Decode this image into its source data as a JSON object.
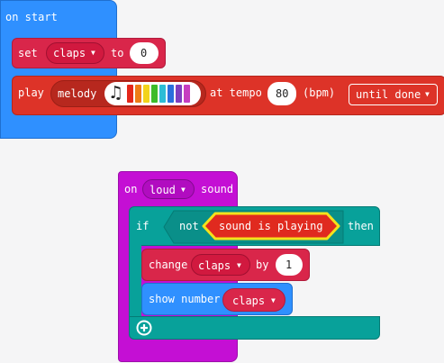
{
  "on_start": {
    "hat_label": "on start",
    "set_block": {
      "keyword": "set",
      "variable": "claps",
      "to_label": "to",
      "value": "0"
    },
    "play_block": {
      "keyword": "play",
      "melody_label": "melody",
      "melody_colors": [
        "#e4271a",
        "#ee7d16",
        "#f2d31b",
        "#3dbb2a",
        "#2cbdd6",
        "#2a6fdc",
        "#7f3fbf",
        "#c63fc0"
      ],
      "tempo_label": "at tempo",
      "tempo_value": "80",
      "unit_label": "(bpm)",
      "mode": "until done"
    }
  },
  "on_loud": {
    "hat_prefix": "on",
    "event": "loud",
    "hat_suffix": "sound",
    "if_block": {
      "keyword": "if",
      "not_label": "not",
      "condition": "sound is playing",
      "then_label": "then"
    },
    "change_block": {
      "keyword": "change",
      "variable": "claps",
      "by_label": "by",
      "value": "1"
    },
    "show_block": {
      "keyword": "show number",
      "variable": "claps"
    }
  },
  "colors": {
    "basic": "#2f90ff",
    "variables": "#d9264a",
    "music": "#dd3328",
    "input": "#c40fd4",
    "logic": "#08a19a",
    "condition_fill": "#e02a1f",
    "condition_border": "#f4e21b"
  }
}
